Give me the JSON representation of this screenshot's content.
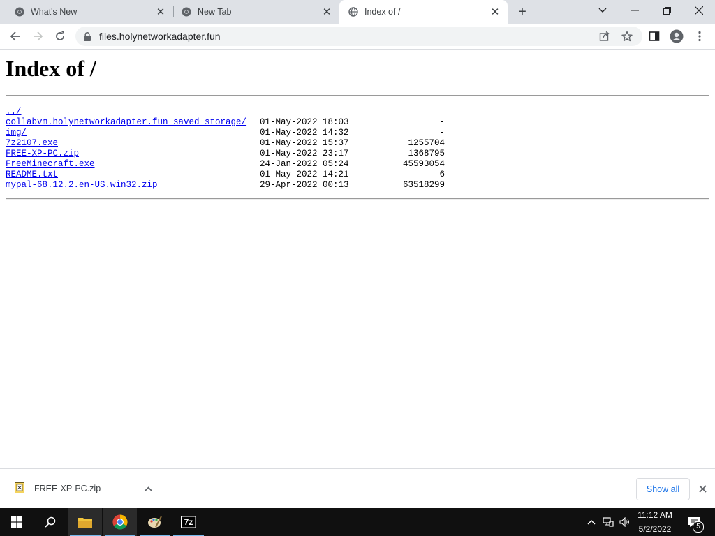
{
  "browser": {
    "tabs": [
      {
        "title": "What's New",
        "active": false
      },
      {
        "title": "New Tab",
        "active": false
      },
      {
        "title": "Index of /",
        "active": true
      }
    ],
    "address": "files.holynetworkadapter.fun"
  },
  "page": {
    "heading": "Index of /",
    "entries": [
      {
        "name": "../",
        "date": "",
        "size": ""
      },
      {
        "name": "collabvm.holynetworkadapter.fun_saved_storage/",
        "date": "01-May-2022 18:03",
        "size": "-"
      },
      {
        "name": "img/",
        "date": "01-May-2022 14:32",
        "size": "-"
      },
      {
        "name": "7z2107.exe",
        "date": "01-May-2022 15:37",
        "size": "1255704"
      },
      {
        "name": "FREE-XP-PC.zip",
        "date": "01-May-2022 23:17",
        "size": "1368795"
      },
      {
        "name": "FreeMinecraft.exe",
        "date": "24-Jan-2022 05:24",
        "size": "45593054"
      },
      {
        "name": "README.txt",
        "date": "01-May-2022 14:21",
        "size": "6"
      },
      {
        "name": "mypal-68.12.2.en-US.win32.zip",
        "date": "29-Apr-2022 00:13",
        "size": "63518299"
      }
    ]
  },
  "downloads": {
    "file": "FREE-XP-PC.zip",
    "show_all": "Show all"
  },
  "taskbar": {
    "time": "11:12 AM",
    "date": "5/2/2022",
    "notification_count": "5",
    "apps": [
      "start-icon",
      "search-icon",
      "file-explorer-icon",
      "chrome-icon",
      "paint-icon",
      "7zip-icon"
    ],
    "sevenzip_label": "7z"
  },
  "colors": {
    "link": "#0000ee",
    "accent": "#1a73e8",
    "tabstrip": "#dee1e6",
    "taskbar": "#101010"
  }
}
